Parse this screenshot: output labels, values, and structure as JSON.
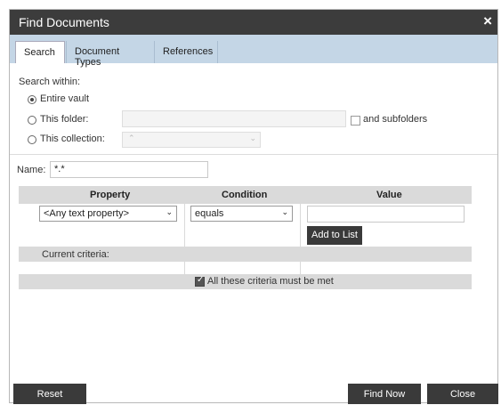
{
  "window": {
    "title": "Find Documents",
    "close_glyph": "×"
  },
  "tabs": [
    {
      "label": "Search"
    },
    {
      "label": "Document Types"
    },
    {
      "label": "References"
    }
  ],
  "search_within": {
    "label": "Search within:",
    "entire_vault": "Entire vault",
    "this_folder": "This folder:",
    "this_collection": "This collection:",
    "and_subfolders": "and subfolders",
    "selected": "entire_vault"
  },
  "name": {
    "label": "Name:",
    "value": "*.*"
  },
  "grid": {
    "headers": {
      "property": "Property",
      "condition": "Condition",
      "value": "Value"
    },
    "property_selected": "<Any text property>",
    "condition_selected": "equals",
    "value_text": "",
    "add_to_list": "Add to List",
    "current_criteria": "Current criteria:",
    "all_criteria": "All these criteria must be met",
    "all_criteria_checked": true
  },
  "footer": {
    "reset": "Reset",
    "find_now": "Find Now",
    "close": "Close"
  }
}
